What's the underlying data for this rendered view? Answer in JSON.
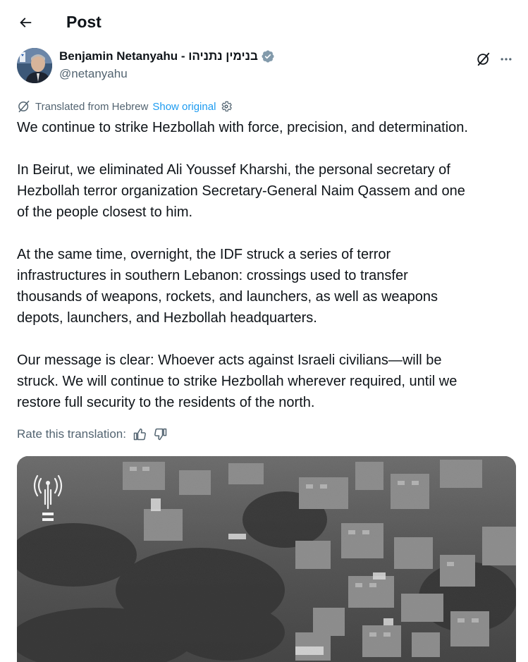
{
  "header": {
    "title": "Post",
    "back_icon": "arrow-left-icon"
  },
  "author": {
    "name": "Benjamin Netanyahu - בנימין נתניהו",
    "handle": "@netanyahu",
    "verified": true,
    "verified_color": "#829aab"
  },
  "translation": {
    "label": "Translated from Hebrew",
    "show_original": "Show original",
    "rate_label": "Rate this translation:"
  },
  "post": {
    "paragraphs": [
      [
        "We continue to strike Hezbollah with force, precision, and determination."
      ],
      [
        "In Beirut, we eliminated Ali Youssef Kharshi, the personal secretary of",
        "Hezbollah terror organization Secretary-General Naim Qassem and one",
        "of the people closest to him."
      ],
      [
        "At the same time, overnight, the IDF struck a series of terror",
        "infrastructures in southern Lebanon: crossings used to transfer",
        "thousands of weapons, rockets, and launchers, as well as weapons",
        "depots, launchers, and Hezbollah headquarters."
      ],
      [
        "Our message is clear: Whoever acts against Israeli civilians—will be",
        "struck. We will continue to strike Hezbollah wherever required, until we",
        "restore full security to the residents of the north."
      ]
    ]
  },
  "colors": {
    "link": "#1d9bf0",
    "secondary_text": "#536471",
    "primary_text": "#0f1419"
  },
  "icons": {
    "grok": "grok-icon",
    "more": "more-icon",
    "translate": "translate-icon",
    "settings": "gear-icon",
    "thumbs_up": "thumbs-up-icon",
    "thumbs_down": "thumbs-down-icon",
    "media_logo": "idf-spokesperson-logo"
  }
}
